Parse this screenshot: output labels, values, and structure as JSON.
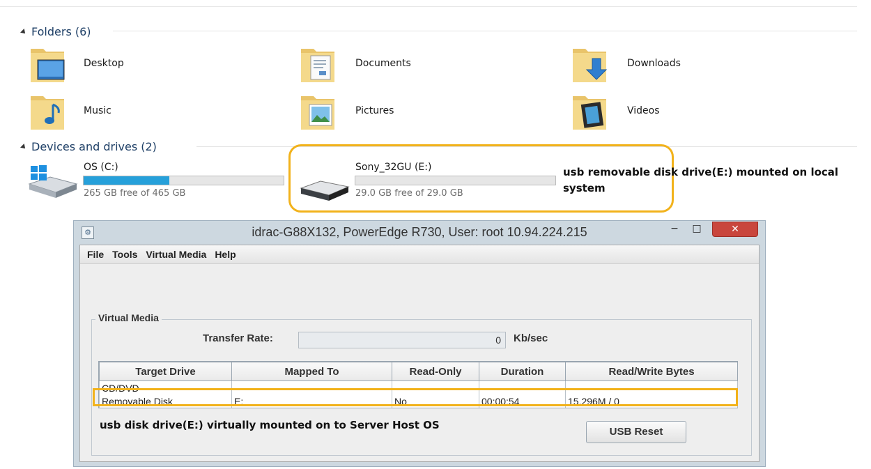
{
  "explorer": {
    "folders_header": "Folders (6)",
    "folders": [
      {
        "label": "Desktop",
        "icon": "desktop-folder-icon"
      },
      {
        "label": "Documents",
        "icon": "documents-folder-icon"
      },
      {
        "label": "Downloads",
        "icon": "downloads-folder-icon"
      },
      {
        "label": "Music",
        "icon": "music-folder-icon"
      },
      {
        "label": "Pictures",
        "icon": "pictures-folder-icon"
      },
      {
        "label": "Videos",
        "icon": "videos-folder-icon"
      }
    ],
    "devices_header": "Devices and drives (2)",
    "drives": [
      {
        "name": "OS (C:)",
        "free_text": "265 GB free of 465 GB",
        "used_fraction": 0.43,
        "icon": "windows-drive-icon"
      },
      {
        "name": "Sony_32GU (E:)",
        "free_text": "29.0 GB free of 29.0 GB",
        "used_fraction": 0.0,
        "icon": "usb-drive-icon"
      }
    ]
  },
  "annotations": {
    "top": "usb removable disk drive(E:) mounted on local system",
    "bottom": "usb disk drive(E:) virtually mounted on to Server Host OS",
    "highlight_color": "#f2b21b"
  },
  "window": {
    "title": "idrac-G88X132, PowerEdge R730, User: root 10.94.224.215",
    "minimize_glyph": "−",
    "maximize_glyph": "□",
    "close_glyph": "✕",
    "menu": [
      "File",
      "Tools",
      "Virtual Media",
      "Help"
    ],
    "group_title": "Virtual Media",
    "transfer_rate_label": "Transfer Rate:",
    "transfer_rate_value": "0",
    "transfer_rate_unit": "Kb/sec",
    "table": {
      "headers": [
        "Target Drive",
        "Mapped To",
        "Read-Only",
        "Duration",
        "Read/Write Bytes"
      ],
      "rows": [
        [
          "CD/DVD",
          "",
          "",
          "",
          ""
        ],
        [
          "Removable Disk",
          "E:",
          "No",
          "00:00:54",
          "15.296M / 0"
        ]
      ]
    },
    "usb_reset_label": "USB Reset"
  }
}
